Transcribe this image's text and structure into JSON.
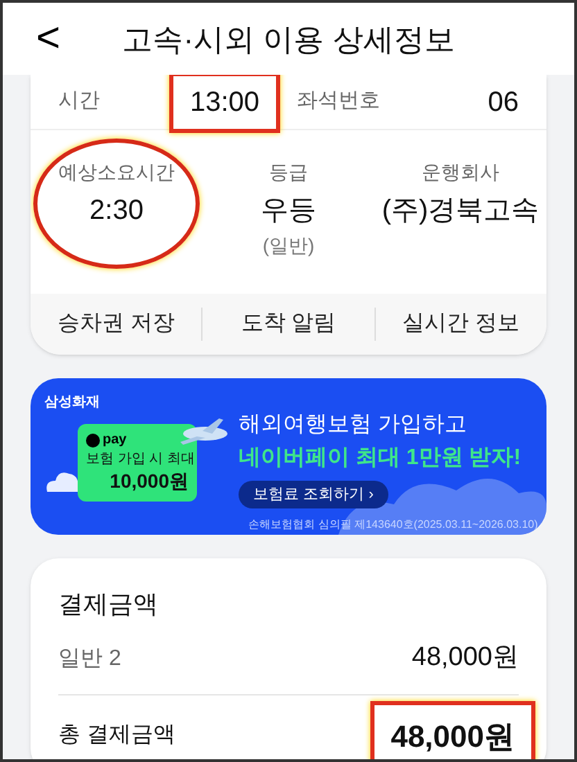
{
  "header": {
    "back": "<",
    "title": "고속·시외 이용 상세정보"
  },
  "trip": {
    "time_label": "시간",
    "time": "13:00",
    "time_highlighted": true,
    "seat_label": "좌석번호",
    "seat": "06",
    "details": [
      {
        "label": "예상소요시간",
        "value": "2:30",
        "highlighted": true
      },
      {
        "label": "등급",
        "value": "우등",
        "sub": "(일반)",
        "highlighted": false
      },
      {
        "label": "운행회사",
        "value": "(주)경북고속",
        "highlighted": false
      }
    ],
    "actions": [
      "승차권 저장",
      "도착 알림",
      "실시간 정보"
    ]
  },
  "banner": {
    "brand": "삼성화재",
    "card_logo": "pay",
    "card_caption": "보험 가입 시 최대",
    "card_amount": "10,000원",
    "headline": "해외여행보험 가입하고",
    "highlight": "네이버페이 최대 1만원 받자!",
    "button": "보험료 조회하기 ›",
    "fine_print": "손해보험협회 심의필 제143640호(2025.03.11~2026.03.10)"
  },
  "payment": {
    "title": "결제금액",
    "rows": [
      {
        "label": "일반 2",
        "amount": "48,000원"
      }
    ],
    "total_label": "총 결제금액",
    "total": "48,000원",
    "total_highlighted": true
  }
}
